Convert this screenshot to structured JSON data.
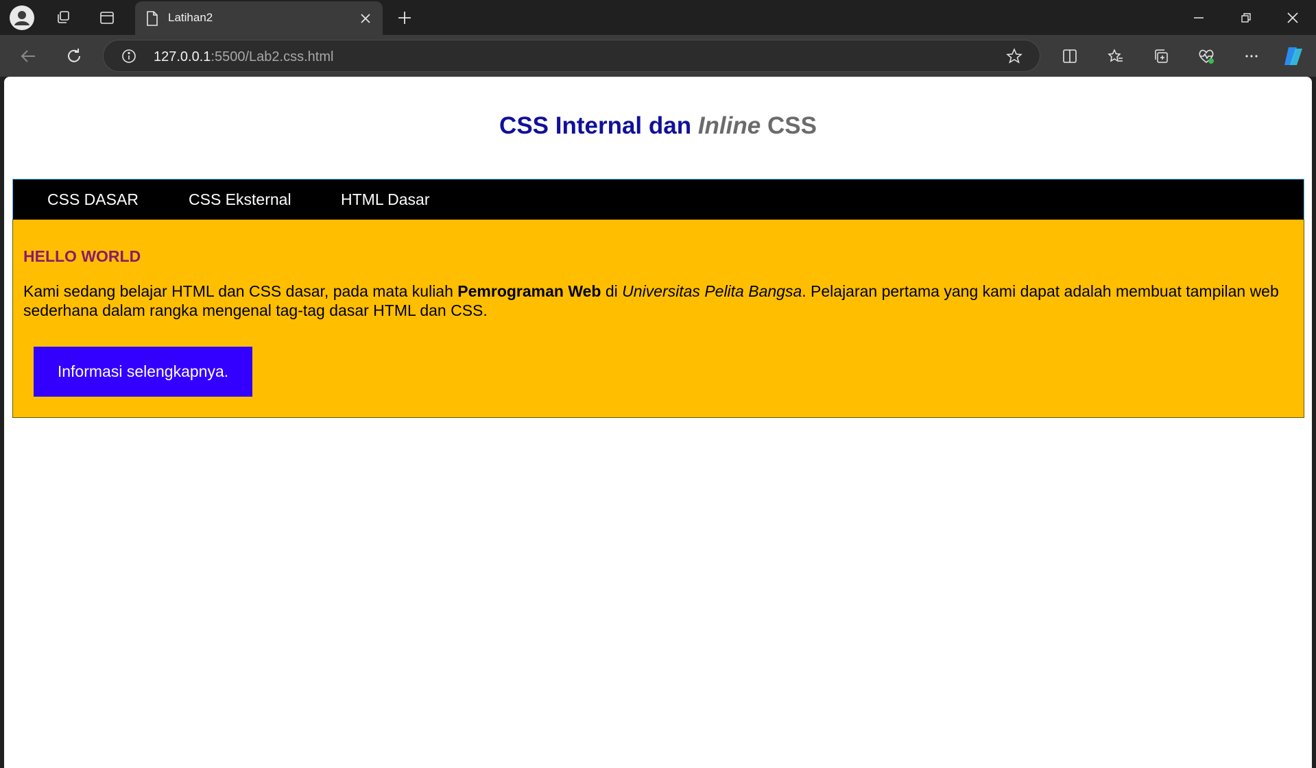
{
  "browser": {
    "tab": {
      "title": "Latihan2"
    },
    "address": {
      "host": "127.0.0.1",
      "rest": ":5500/Lab2.css.html"
    }
  },
  "page": {
    "title": {
      "part1": "CSS Internal dan ",
      "part2_italic": "Inline",
      "part3": " CSS"
    },
    "nav": {
      "items": [
        {
          "label": "CSS DASAR"
        },
        {
          "label": "CSS Eksternal"
        },
        {
          "label": "HTML Dasar"
        }
      ]
    },
    "content": {
      "heading": "HELLO WORLD",
      "para": {
        "t1": "Kami sedang belajar HTML dan CSS dasar, pada mata kuliah ",
        "bold": "Pemrograman Web",
        "t2": " di ",
        "italic": "Universitas Pelita Bangsa",
        "t3": ". Pelajaran pertama yang kami dapat adalah membuat tampilan web sederhana dalam rangka mengenal tag-tag dasar HTML dan CSS."
      },
      "button": "Informasi selengkapnya."
    }
  }
}
